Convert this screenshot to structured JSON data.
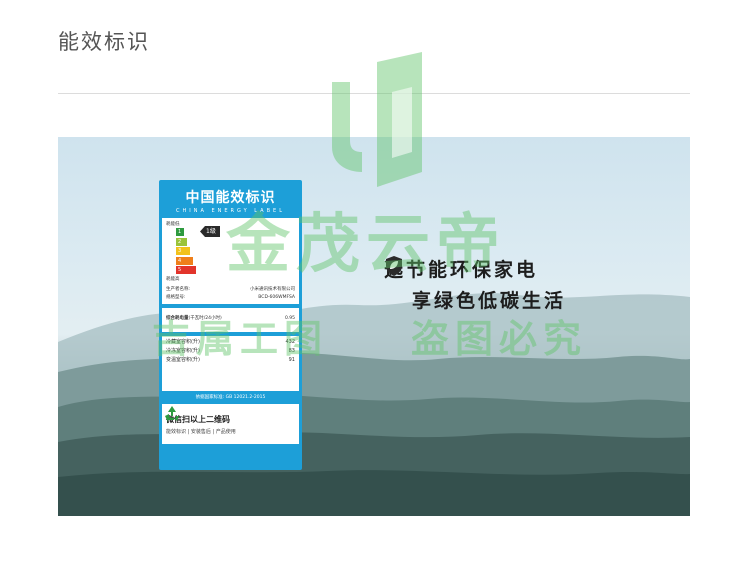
{
  "page": {
    "title": "能效标识"
  },
  "label": {
    "title": "中国能效标识",
    "subtitle": "CHINA ENERGY LABEL",
    "low_label": "耗能低",
    "high_label": "耗能高",
    "grades": [
      "1",
      "2",
      "3",
      "4",
      "5"
    ],
    "grade_colors": [
      "#2e9a3f",
      "#9ac33a",
      "#f2c21b",
      "#ef7f1a",
      "#e2342b"
    ],
    "current_grade": "1级",
    "producer_label": "生产者名称:",
    "producer_value": "小米通讯技术有限公司",
    "model_label": "规格型号:",
    "model_value": "BCD-606WMFSA",
    "consumption_label": "综合耗电量",
    "consumption_unit": "(千瓦时/24小时)",
    "consumption_value": "0.95",
    "volumes": [
      {
        "label": "冷藏室容积(升)",
        "value": "432"
      },
      {
        "label": "冷冻室容积(升)",
        "value": "83"
      },
      {
        "label": "变温室容积(升)",
        "value": "91"
      }
    ],
    "standard": "依据国家标准: GB 12021.2-2015",
    "qr_main": "微信扫以上二维码",
    "qr_sub": "能效标识 | 安装售后 | 产品使用"
  },
  "slogan": {
    "line1": "选节能环保家电",
    "line2": "享绿色低碳生活"
  },
  "watermark": {
    "brand": "金茂云帝",
    "left": "吉属工图",
    "right": "盗图必究"
  },
  "colors": {
    "label_blue": "#1d9fd8",
    "watermark_green": "#60c468"
  }
}
